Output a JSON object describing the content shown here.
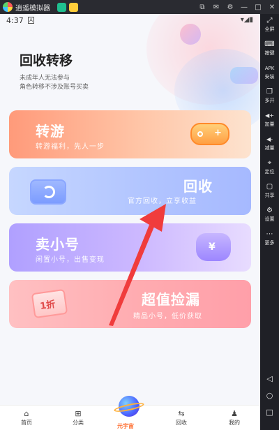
{
  "titlebar": {
    "title": "逍遥模拟器",
    "controls": [
      "⧉",
      "✉",
      "⚙",
      "—",
      "□",
      "✕"
    ]
  },
  "statusbar": {
    "time": "4:37",
    "a_icon": "A",
    "right": "▾◢▮"
  },
  "header": {
    "title": "回收转移",
    "sub1": "未成年人无法参与",
    "sub2": "角色转移不涉及账号买卖"
  },
  "cards": [
    {
      "title": "转游",
      "sub": "转游福利，先人一步"
    },
    {
      "title": "回收",
      "sub": "官方回收，立享收益"
    },
    {
      "title": "卖小号",
      "sub": "闲置小号，出售变现"
    },
    {
      "title": "超值捡漏",
      "sub": "精品小号，低价获取",
      "tag": "1折"
    }
  ],
  "sidebar": [
    {
      "icon": "⤢",
      "label": "全屏"
    },
    {
      "icon": "⌨",
      "label": "按键"
    },
    {
      "icon": "APK",
      "label": "安装"
    },
    {
      "icon": "❐",
      "label": "多开"
    },
    {
      "icon": "◀+",
      "label": "加量"
    },
    {
      "icon": "◀-",
      "label": "减量"
    },
    {
      "icon": "⌖",
      "label": "定位"
    },
    {
      "icon": "▢",
      "label": "共享"
    },
    {
      "icon": "⚙",
      "label": "设置"
    },
    {
      "icon": "⋯",
      "label": "更多"
    }
  ],
  "androidnav": {
    "back": "◁",
    "home": "○",
    "recent": "□"
  },
  "bottomnav": {
    "home": "首页",
    "home_icon": "⌂",
    "category": "分类",
    "category_icon": "⊞",
    "universe": "元宇宙",
    "recycle": "回收",
    "recycle_icon": "⇆",
    "mine": "我的",
    "mine_icon": "♟"
  },
  "misc": {
    "yuan": "¥",
    "plus": "+"
  },
  "colors": {
    "accent_arrow": "#f03c3c"
  }
}
